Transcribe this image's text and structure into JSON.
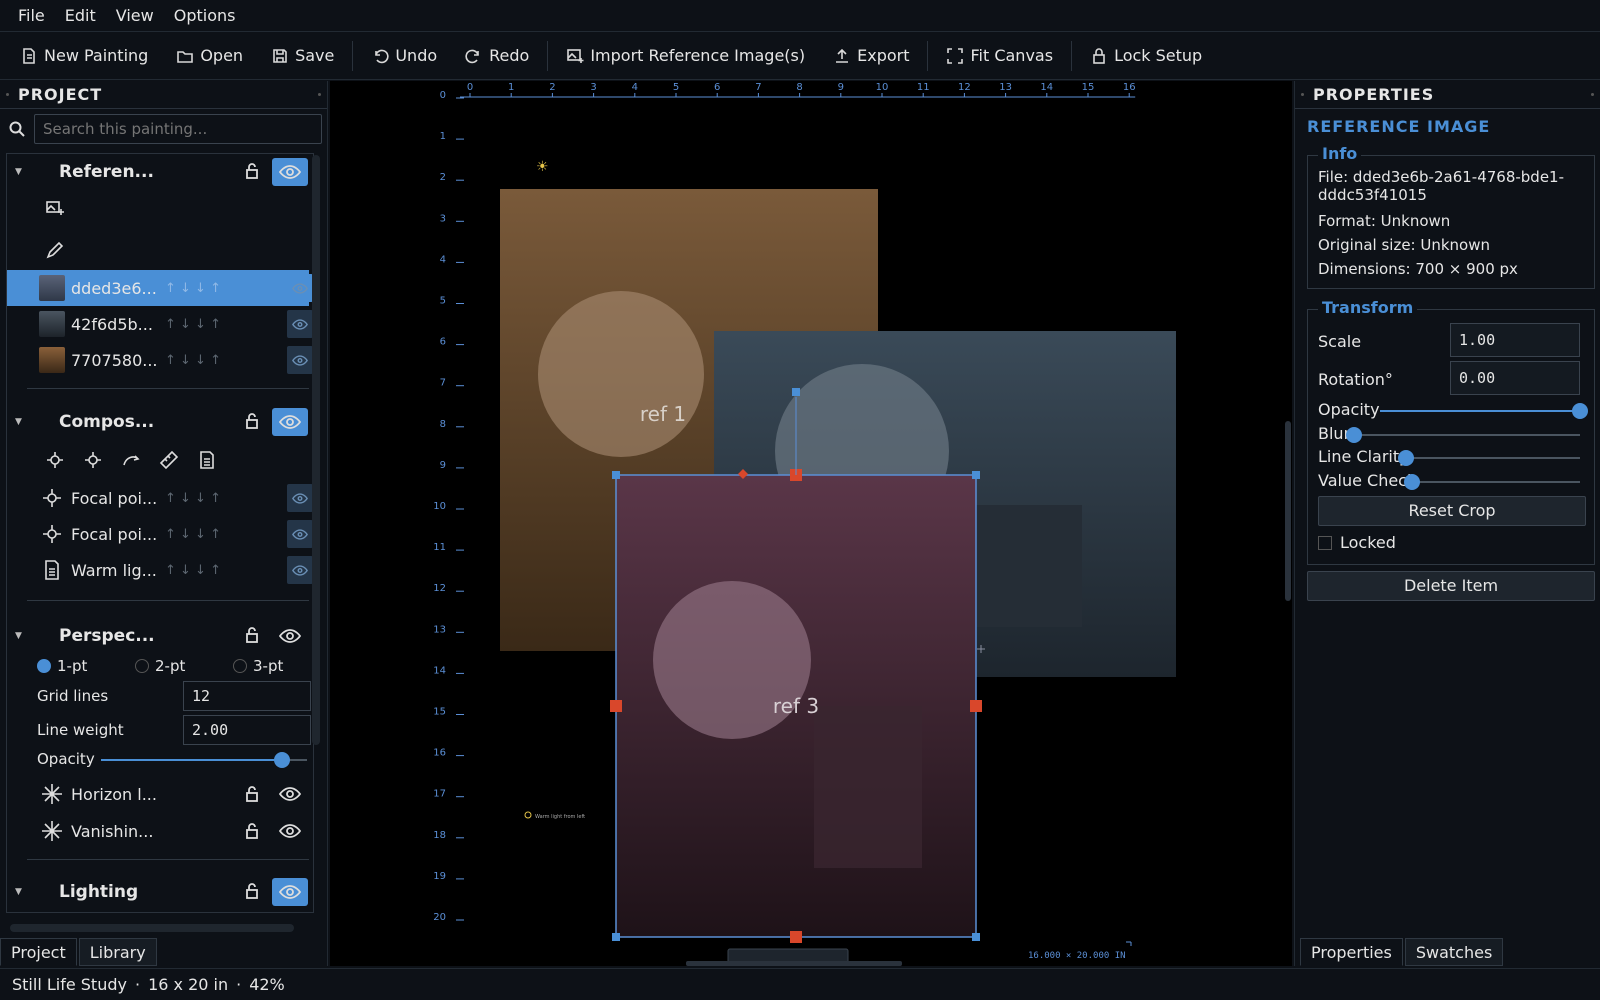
{
  "menu": [
    "File",
    "Edit",
    "View",
    "Options"
  ],
  "toolbar": {
    "new_painting": "New Painting",
    "open": "Open",
    "save": "Save",
    "undo": "Undo",
    "redo": "Redo",
    "import_ref": "Import Reference Image(s)",
    "export": "Export",
    "fit_canvas": "Fit Canvas",
    "lock_setup": "Lock Setup"
  },
  "left_panel": {
    "title": "PROJECT",
    "search_placeholder": "Search this painting...",
    "groups": {
      "references": "Referen...",
      "composition": "Compos...",
      "perspective": "Perspec...",
      "lighting": "Lighting"
    },
    "ref_items": [
      "dded3e6...",
      "42f6d5b...",
      "7707580..."
    ],
    "comp_items": [
      "Focal poi...",
      "Focal poi...",
      "Warm lig..."
    ],
    "perspective": {
      "radios": [
        "1-pt",
        "2-pt",
        "3-pt"
      ],
      "selected": "1-pt",
      "grid_lines_label": "Grid lines",
      "grid_lines_value": "12",
      "line_weight_label": "Line weight",
      "line_weight_value": "2.00",
      "opacity_label": "Opacity",
      "opacity_fraction": 0.88,
      "items": [
        "Horizon l...",
        "Vanishin..."
      ]
    },
    "tabs": [
      "Project",
      "Library"
    ]
  },
  "canvas": {
    "ruler_top": [
      "0",
      "1",
      "2",
      "3",
      "4",
      "5",
      "6",
      "7",
      "8",
      "9",
      "10",
      "11",
      "12",
      "13",
      "14",
      "15",
      "16"
    ],
    "ruler_left": [
      "0",
      "1",
      "2",
      "3",
      "4",
      "5",
      "6",
      "7",
      "8",
      "9",
      "10",
      "11",
      "12",
      "13",
      "14",
      "15",
      "16",
      "17",
      "18",
      "19",
      "20"
    ],
    "ref1_label": "ref 1",
    "ref3_label": "ref 3",
    "note_text": "Warm light from left",
    "size_label": "16.000 × 20.000 IN",
    "colors": {
      "ref1": "#7a5a3a",
      "ref2": "#34434f",
      "ref3": "#5a3648",
      "handle": "#d9472b",
      "selection": "#5b8fd6"
    }
  },
  "right_panel": {
    "title": "PROPERTIES",
    "section": "REFERENCE IMAGE",
    "info_legend": "Info",
    "file_line1": "File: dded3e6b-2a61-4768-bde1-",
    "file_line2": "dddc53f41015",
    "format": "Format: Unknown",
    "original_size": "Original size: Unknown",
    "dimensions": "Dimensions: 700 × 900 px",
    "transform_legend": "Transform",
    "scale_label": "Scale",
    "scale_value": "1.00",
    "rotation_label": "Rotation°",
    "rotation_value": "0.00",
    "opacity_label": "Opacity",
    "opacity_fraction": 1.0,
    "blur_label": "Blur",
    "blur_fraction": 0.0,
    "line_clarity_label": "Line Clarity",
    "line_clarity_fraction": 0.0,
    "value_check_label": "Value Check",
    "value_check_fraction": 0.0,
    "reset_crop": "Reset Crop",
    "locked_label": "Locked",
    "delete_item": "Delete Item",
    "tabs": [
      "Properties",
      "Swatches"
    ]
  },
  "status": {
    "name": "Still Life Study",
    "size": "16 x 20 in",
    "zoom": "42%",
    "sep": "·"
  }
}
